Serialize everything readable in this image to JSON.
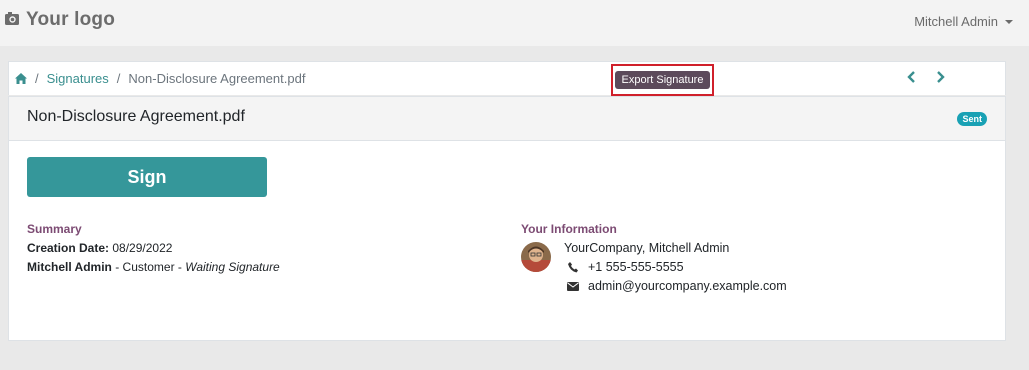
{
  "header": {
    "logo_text": "Your logo",
    "user_name": "Mitchell Admin"
  },
  "breadcrumb": {
    "parent": "Signatures",
    "current": "Non-Disclosure Agreement.pdf",
    "separator": "/"
  },
  "toolbar": {
    "export_label": "Export Signature"
  },
  "document": {
    "title": "Non-Disclosure Agreement.pdf",
    "status": "Sent",
    "sign_label": "Sign"
  },
  "summary": {
    "title": "Summary",
    "creation_label": "Creation Date:",
    "creation_value": "08/29/2022",
    "signer_name": "Mitchell Admin",
    "signer_role": " - Customer - ",
    "signer_status": "Waiting Signature"
  },
  "your_info": {
    "title": "Your Information",
    "company": "YourCompany, Mitchell Admin",
    "phone": "+1 555-555-5555",
    "email": "admin@yourcompany.example.com"
  },
  "colors": {
    "accent": "#35979a",
    "section_title": "#7c4b73",
    "badge": "#19a1b4",
    "export_btn": "#5c4a5b",
    "highlight_box": "#d0202b"
  },
  "icons": [
    "camera-icon",
    "home-icon",
    "chevron-left-icon",
    "chevron-right-icon",
    "phone-icon",
    "envelope-icon"
  ]
}
